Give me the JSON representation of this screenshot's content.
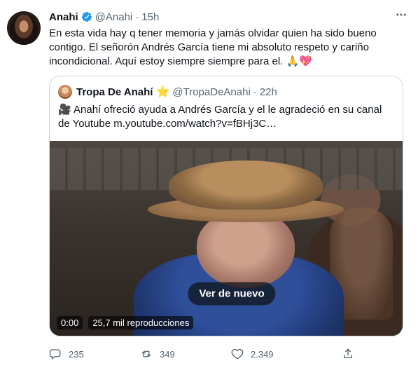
{
  "author": {
    "name": "Anahi",
    "handle": "@Anahi",
    "dot": "·",
    "time": "15h"
  },
  "tweet_text": "En esta vida hay q tener memoria y jamás olvidar quien ha sido bueno contigo. El señorón Andrés García tiene mi absoluto respeto y cariño incondicional. Aquí estoy siempre siempre para el. 🙏💖",
  "quote": {
    "name": "Tropa De Anahí",
    "star": "⭐",
    "handle": "@TropaDeAnahi",
    "dot": "·",
    "time": "22h",
    "text": "🎥 Anahí ofreció ayuda a Andrés García y el le agradeció en su canal de Youtube  m.youtube.com/watch?v=fBHj3C…",
    "video": {
      "replay_label": "Ver de nuevo",
      "time": "0:00",
      "views": "25,7 mil reproducciones"
    }
  },
  "actions": {
    "reply_count": "235",
    "retweet_count": "349",
    "like_count": "2.349"
  },
  "colors": {
    "text": "#0f1419",
    "secondary": "#536471",
    "verified": "#1d9bf0",
    "border": "#cfd9de"
  }
}
